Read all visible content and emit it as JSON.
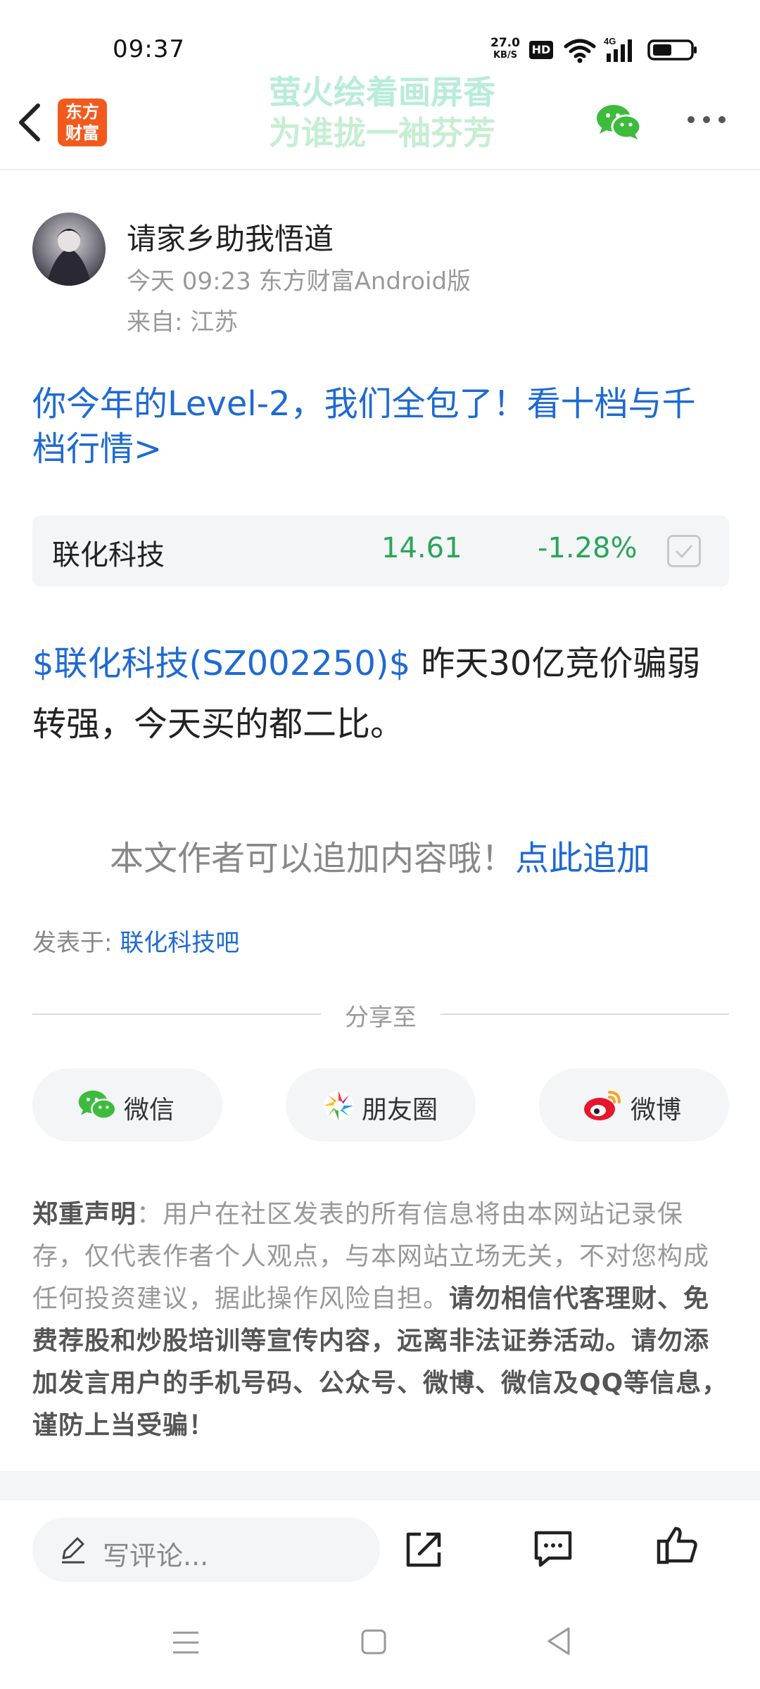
{
  "status_bar": {
    "time": "09:37",
    "net_speed_value": "27.0",
    "net_speed_unit": "KB/S",
    "hd": "HD",
    "network": "4G"
  },
  "header": {
    "logo_line1": "东方",
    "logo_line2": "财富",
    "slogan_line1": "萤火绘着画屏香",
    "slogan_line2": "为谁拢一袖芬芳"
  },
  "post": {
    "author": "请家乡助我悟道",
    "meta": "今天 09:23 东方财富Android版",
    "location": "来自: 江苏",
    "promo": "你今年的Level-2，我们全包了！看十档与千档行情>",
    "quote": {
      "name": "联化科技",
      "price": "14.61",
      "change": "-1.28%"
    },
    "content_tag": "$联化科技(SZ002250)$",
    "content_text": " 昨天30亿竞价骗弱转强，今天买的都二比。",
    "append_text": "本文作者可以追加内容哦！",
    "append_link": "点此追加",
    "posted_in_label": "发表于: ",
    "posted_in_bar": "联化科技吧"
  },
  "share": {
    "title": "分享至",
    "wechat": "微信",
    "moments": "朋友圈",
    "weibo": "微博"
  },
  "disclaimer": {
    "label": "郑重声明",
    "normal": "：用户在社区发表的所有信息将由本网站记录保存，仅代表作者个人观点，与本网站立场无关，不对您构成任何投资建议，据此操作风险自担。",
    "strong": "请勿相信代客理财、免费荐股和炒股培训等宣传内容，远离非法证券活动。请勿添加发言用户的手机号码、公众号、微博、微信及QQ等信息，谨防上当受骗！"
  },
  "bottom_bar": {
    "comment_placeholder": "写评论..."
  },
  "colors": {
    "link_blue": "#1e6ad1",
    "down_green": "#2aa55a",
    "brand_orange": "#f25a1d",
    "wechat_green": "#3dbb3d",
    "weibo_red": "#e6162d"
  },
  "icons": [
    "back-icon",
    "wechat-icon",
    "more-icon",
    "pen-icon",
    "share-icon",
    "comment-icon",
    "like-icon",
    "weibo-icon",
    "moments-icon"
  ]
}
